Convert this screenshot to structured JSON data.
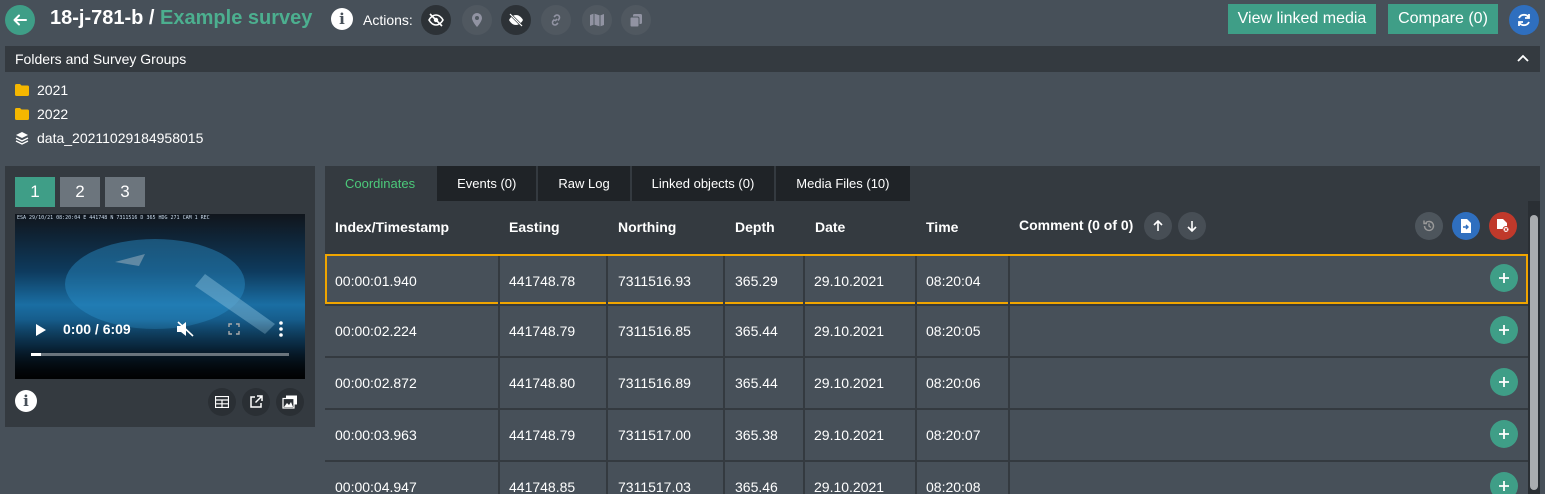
{
  "header": {
    "device": "18-j-781-b",
    "separator": " / ",
    "survey": "Example survey",
    "info_icon_text": "i",
    "actions_label": "Actions:",
    "actions": [
      {
        "icon": "eye-slash-icon",
        "enabled": true
      },
      {
        "icon": "map-pin-icon",
        "enabled": false
      },
      {
        "icon": "eye-off-icon",
        "enabled": true
      },
      {
        "icon": "link-icon",
        "enabled": false
      },
      {
        "icon": "map-icon",
        "enabled": false
      },
      {
        "icon": "copy-icon",
        "enabled": false
      }
    ],
    "view_linked_media": "View linked media",
    "compare": "Compare (0)"
  },
  "folders": {
    "title": "Folders and Survey Groups",
    "items": [
      {
        "label": "2021",
        "icon": "folder-icon"
      },
      {
        "label": "2022",
        "icon": "folder-icon"
      },
      {
        "label": "data_20211029184958015",
        "icon": "layers-icon"
      }
    ]
  },
  "media": {
    "pages": [
      "1",
      "2",
      "3"
    ],
    "active_page": "1",
    "video": {
      "time": "0:00 / 6:09",
      "progress": 0.0,
      "overlay_text": "ESA 29/10/21 08:20:04  E 441748 N 7311516  D 365  HDG 271   CAM 1   REC"
    },
    "info_icon_text": "i"
  },
  "table": {
    "tabs": [
      "Coordinates",
      "Events (0)",
      "Raw Log",
      "Linked objects (0)",
      "Media Files (10)"
    ],
    "active_tab": "Coordinates",
    "columns": [
      "Index/Timestamp",
      "Easting",
      "Northing",
      "Depth",
      "Date",
      "Time"
    ],
    "comment_label": "Comment (0 of 0)",
    "rows": [
      {
        "index": "00:00:01.940",
        "easting": "441748.78",
        "northing": "7311516.93",
        "depth": "365.29",
        "date": "29.10.2021",
        "time": "08:20:04",
        "selected": true
      },
      {
        "index": "00:00:02.224",
        "easting": "441748.79",
        "northing": "7311516.85",
        "depth": "365.44",
        "date": "29.10.2021",
        "time": "08:20:05",
        "selected": false
      },
      {
        "index": "00:00:02.872",
        "easting": "441748.80",
        "northing": "7311516.89",
        "depth": "365.44",
        "date": "29.10.2021",
        "time": "08:20:06",
        "selected": false
      },
      {
        "index": "00:00:03.963",
        "easting": "441748.79",
        "northing": "7311517.00",
        "depth": "365.38",
        "date": "29.10.2021",
        "time": "08:20:07",
        "selected": false
      },
      {
        "index": "00:00:04.947",
        "easting": "441748.85",
        "northing": "7311517.03",
        "depth": "365.46",
        "date": "29.10.2021",
        "time": "08:20:08",
        "selected": false
      }
    ]
  },
  "colors": {
    "accent": "#3f9e87",
    "selected_border": "#f0a500",
    "background": "#475059",
    "panel": "#343a40",
    "delete": "#c0392b",
    "upload": "#2f6fbf"
  }
}
